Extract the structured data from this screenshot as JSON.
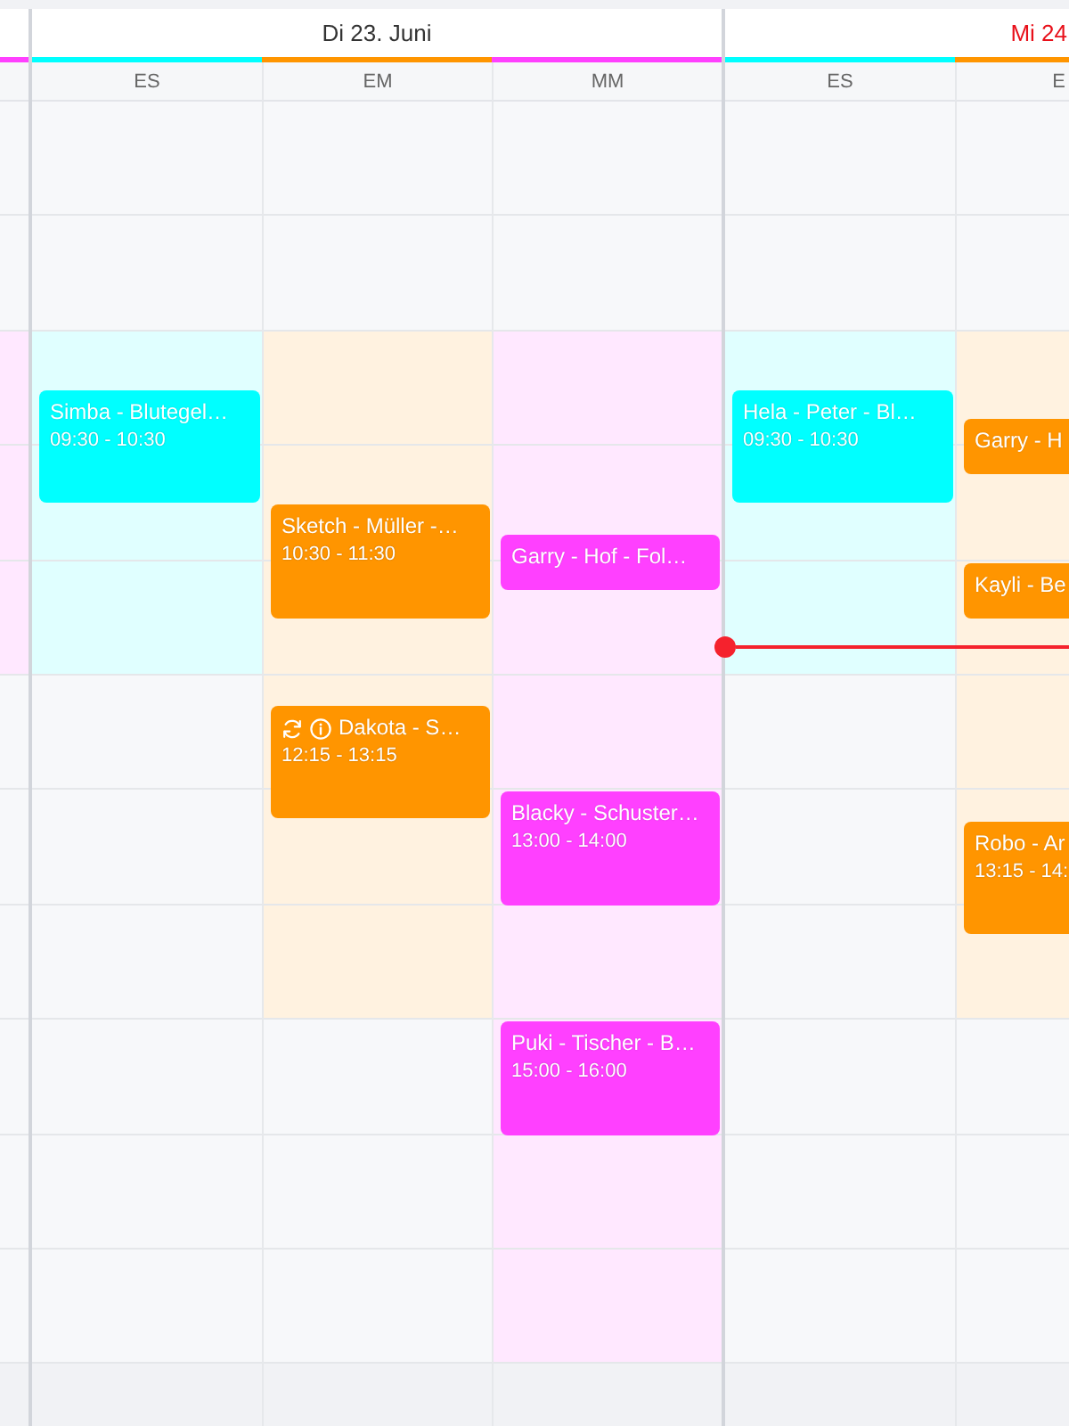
{
  "days": [
    {
      "today": false,
      "columns": [
        {
          "color": "#ff40ff",
          "available": [
            false,
            false,
            true,
            true,
            true,
            false,
            false,
            false,
            false,
            false,
            false
          ]
        }
      ]
    },
    {
      "label": "Di 23. Juni",
      "today": false,
      "columns": [
        {
          "label": "ES",
          "color": "#00ffff",
          "available": [
            false,
            false,
            true,
            true,
            true,
            false,
            false,
            false,
            false,
            false,
            false
          ],
          "events": [
            {
              "title": "Simba - Blutegel…",
              "time": "09:30 - 10:30",
              "recurring": false,
              "info": false
            }
          ]
        },
        {
          "label": "EM",
          "color": "#ff9500",
          "available": [
            false,
            false,
            true,
            true,
            true,
            true,
            true,
            true,
            false,
            false,
            false
          ],
          "events": [
            {
              "title": "Sketch - Müller -…",
              "time": "10:30 - 11:30",
              "recurring": false,
              "info": false
            },
            {
              "title": "Dakota - S…",
              "time": "12:15 - 13:15",
              "recurring": true,
              "info": true
            }
          ]
        },
        {
          "label": "MM",
          "color": "#ff40ff",
          "available": [
            false,
            false,
            true,
            true,
            true,
            true,
            true,
            true,
            true,
            true,
            true
          ],
          "events": [
            {
              "title": "Garry - Hof - Fol…",
              "recurring": false,
              "info": false
            },
            {
              "title": "Blacky - Schuster…",
              "time": "13:00 - 14:00",
              "recurring": false,
              "info": false
            },
            {
              "title": "Puki - Tischer - B…",
              "time": "15:00 - 16:00",
              "recurring": false,
              "info": false
            }
          ]
        }
      ]
    },
    {
      "label": "Mi 24",
      "today": true,
      "columns": [
        {
          "label": "ES",
          "color": "#00ffff",
          "available": [
            false,
            false,
            true,
            true,
            true,
            false,
            false,
            false,
            false,
            false,
            false
          ],
          "events": [
            {
              "title": "Hela - Peter - Bl…",
              "time": "09:30 - 10:30",
              "recurring": false,
              "info": false
            }
          ]
        },
        {
          "label": "E",
          "color": "#ff9500",
          "available": [
            false,
            false,
            true,
            true,
            true,
            true,
            true,
            true,
            false,
            false,
            false
          ],
          "events": [
            {
              "title": "Garry - H",
              "recurring": false,
              "info": false
            },
            {
              "title": "Kayli - Be",
              "recurring": false,
              "info": false
            },
            {
              "title": "Robo - Ar",
              "time": "13:15 - 14:",
              "recurring": false,
              "info": false
            }
          ]
        }
      ]
    }
  ]
}
